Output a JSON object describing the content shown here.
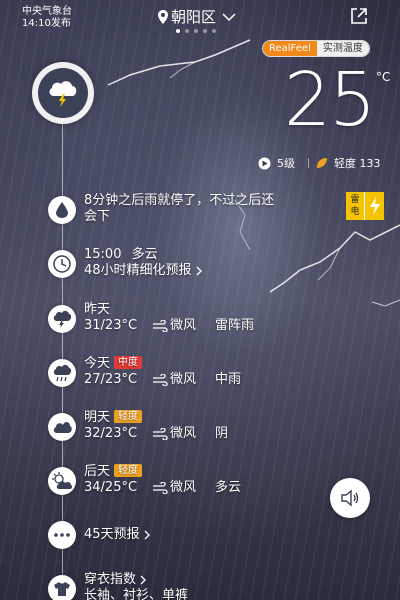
{
  "header": {
    "source": "中央气象台",
    "publish_time": "14:10发布",
    "location": "朝阳区"
  },
  "temp_toggle": {
    "realfeel_label": "RealFeel",
    "measured_label": "实测温度"
  },
  "current": {
    "temperature": "25",
    "unit": "°C",
    "wind_level": "5级",
    "air_quality": "轻度 133"
  },
  "warning": {
    "line1": "雷",
    "line2": "电",
    "color": "#f5c400"
  },
  "timeline": {
    "rain_alert": "8分钟之后雨就停了，不过之后还会下",
    "hourly_time": "15:00",
    "hourly_cond": "多云",
    "hourly_link": "48小时精细化预报",
    "days": [
      {
        "name": "昨天",
        "badge": "",
        "temps": "31/23°C",
        "wind": "微风",
        "cond": "雷阵雨",
        "icon": "thunder-icon"
      },
      {
        "name": "今天",
        "badge": "中度",
        "badge_color": "#e53935",
        "temps": "27/23°C",
        "wind": "微风",
        "cond": "中雨",
        "icon": "rain-icon"
      },
      {
        "name": "明天",
        "badge": "轻度",
        "badge_color": "#f0a020",
        "temps": "32/23°C",
        "wind": "微风",
        "cond": "阴",
        "icon": "cloudy-icon"
      },
      {
        "name": "后天",
        "badge": "轻度",
        "badge_color": "#f0a020",
        "temps": "34/25°C",
        "wind": "微风",
        "cond": "多云",
        "icon": "partly-cloudy-icon"
      }
    ],
    "forecast_45": "45天预报",
    "clothing_title": "穿衣指数",
    "clothing_desc": "长袖、衬衫、单裤"
  },
  "accent": "#f28a1a"
}
